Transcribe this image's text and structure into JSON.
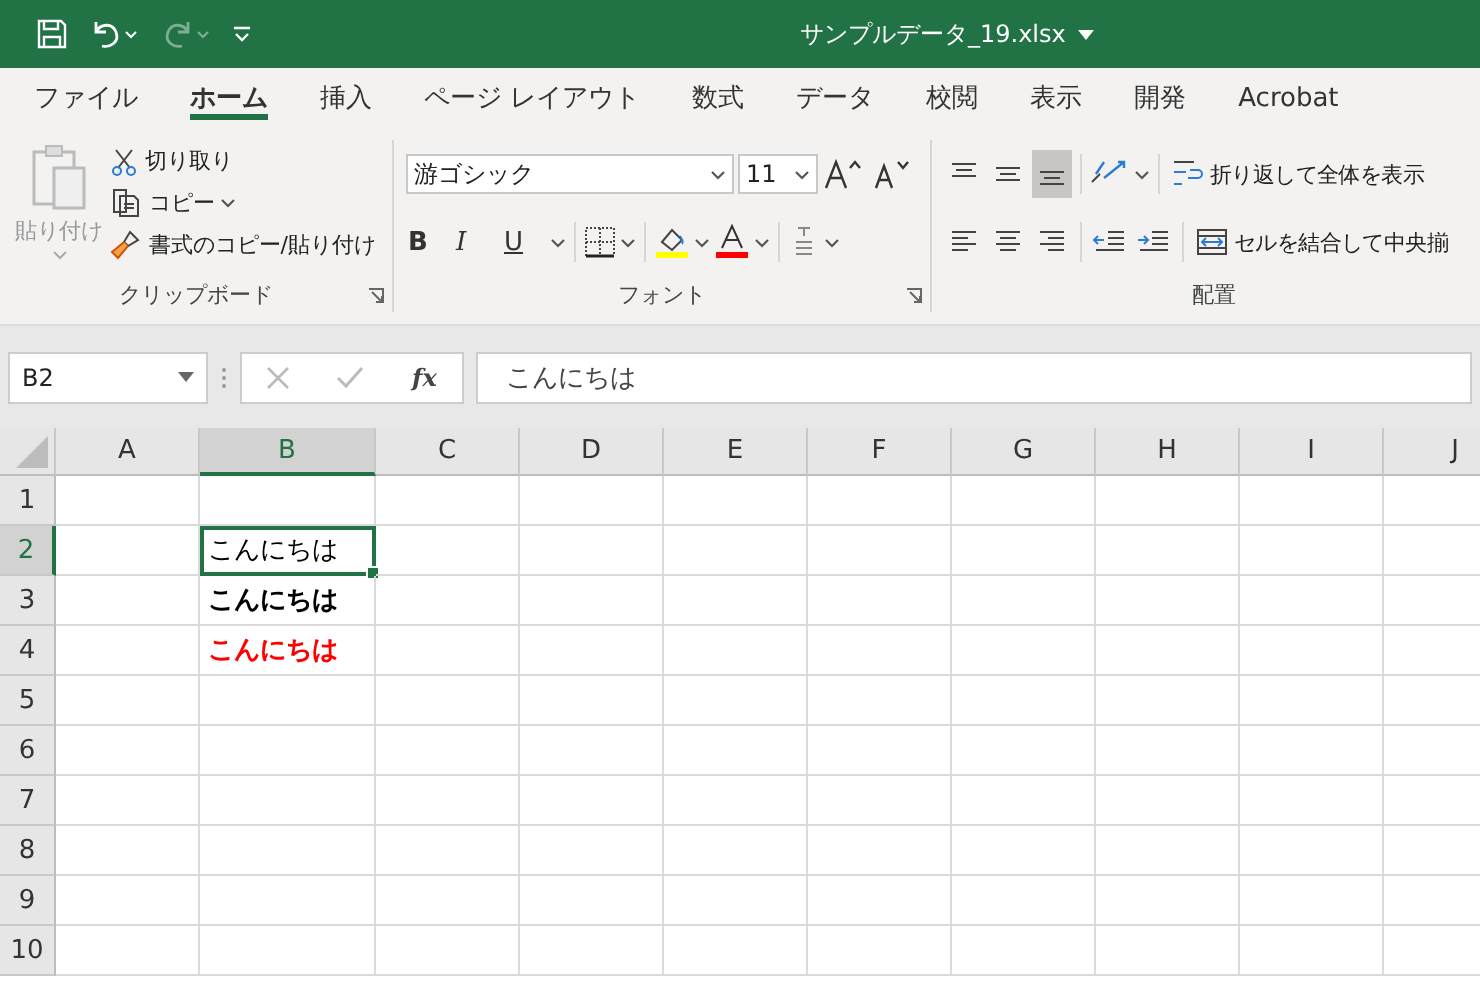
{
  "title_bar": {
    "filename": "サンプルデータ_19.xlsx"
  },
  "menu_tabs": [
    {
      "label": "ファイル",
      "selected": false
    },
    {
      "label": "ホーム",
      "selected": true
    },
    {
      "label": "挿入",
      "selected": false
    },
    {
      "label": "ページ レイアウト",
      "selected": false
    },
    {
      "label": "数式",
      "selected": false
    },
    {
      "label": "データ",
      "selected": false
    },
    {
      "label": "校閲",
      "selected": false
    },
    {
      "label": "表示",
      "selected": false
    },
    {
      "label": "開発",
      "selected": false
    },
    {
      "label": "Acrobat",
      "selected": false
    }
  ],
  "ribbon": {
    "clipboard": {
      "paste_label": "貼り付け",
      "paste_disabled": true,
      "cut": "切り取り",
      "copy": "コピー",
      "format_painter": "書式のコピー/貼り付け",
      "group_label": "クリップボード"
    },
    "font": {
      "font_name": "游ゴシック",
      "font_size": "11",
      "bold": "B",
      "italic": "I",
      "underline": "U",
      "group_label": "フォント"
    },
    "alignment": {
      "vertical": [
        {
          "selected": false
        },
        {
          "selected": false
        },
        {
          "selected": true
        }
      ],
      "wrap_text": "折り返して全体を表示",
      "merge_center": "セルを結合して中央揃",
      "group_label": "配置"
    }
  },
  "formula_bar": {
    "name_box": "B2",
    "function_label": "fx",
    "formula": "こんにちは"
  },
  "sheet": {
    "columns": [
      {
        "label": "A",
        "selected": false
      },
      {
        "label": "B",
        "selected": true
      },
      {
        "label": "C",
        "selected": false
      },
      {
        "label": "D",
        "selected": false
      },
      {
        "label": "E",
        "selected": false
      },
      {
        "label": "F",
        "selected": false
      },
      {
        "label": "G",
        "selected": false
      },
      {
        "label": "H",
        "selected": false
      },
      {
        "label": "I",
        "selected": false
      },
      {
        "label": "J",
        "selected": false
      }
    ],
    "rows": [
      {
        "label": "1",
        "selected": false
      },
      {
        "label": "2",
        "selected": true,
        "column_b": {
          "text": "こんにちは",
          "bold": false,
          "color": "#000000",
          "selected": true
        }
      },
      {
        "label": "3",
        "selected": false,
        "column_b": {
          "text": "こんにちは",
          "bold": true,
          "color": "#000000",
          "selected": false
        }
      },
      {
        "label": "4",
        "selected": false,
        "column_b": {
          "text": "こんにちは",
          "bold": true,
          "color": "#ff0000",
          "selected": false
        }
      },
      {
        "label": "5",
        "selected": false
      },
      {
        "label": "6",
        "selected": false
      },
      {
        "label": "7",
        "selected": false
      },
      {
        "label": "8",
        "selected": false
      },
      {
        "label": "9",
        "selected": false
      },
      {
        "label": "10",
        "selected": false
      }
    ]
  }
}
